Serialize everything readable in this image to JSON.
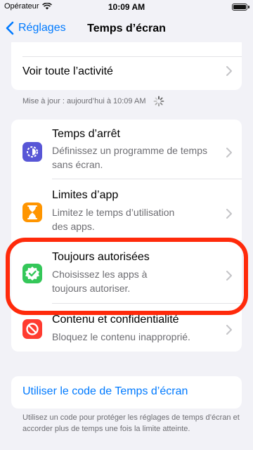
{
  "status_bar": {
    "carrier": "Opérateur",
    "time": "10:09 AM"
  },
  "nav": {
    "back_label": "Réglages",
    "title": "Temps d’écran"
  },
  "top_card": {
    "activity_label": "Voir toute l’activité"
  },
  "update_status": "Mise à jour : aujourd’hui à 10:09 AM",
  "items": [
    {
      "title": "Temps d’arrêt",
      "subtitle_line1": "Définissez un programme de temps",
      "subtitle_line2": "sans écran.",
      "icon": "downtime-icon",
      "color": "#5856d6"
    },
    {
      "title": "Limites d’app",
      "subtitle_line1": "Limitez le temps d’utilisation",
      "subtitle_line2": "des apps.",
      "icon": "hourglass-icon",
      "color": "#ff9500"
    },
    {
      "title": "Toujours autorisées",
      "subtitle_line1": "Choisissez les apps à",
      "subtitle_line2": "toujours autoriser.",
      "icon": "checkmark-shield-icon",
      "color": "#34c759"
    },
    {
      "title": "Contenu et confidentialité",
      "subtitle_line1": "Bloquez le contenu inapproprié.",
      "subtitle_line2": "",
      "icon": "restriction-icon",
      "color": "#ff3b30"
    }
  ],
  "passcode_link": "Utiliser le code de Temps d’écran",
  "footer_note": "Utilisez un code pour protéger les réglages de temps d’écran et accorder plus de temps une fois la limite atteinte.",
  "colors": {
    "accent": "#007aff",
    "highlight": "#ff2a0b"
  }
}
